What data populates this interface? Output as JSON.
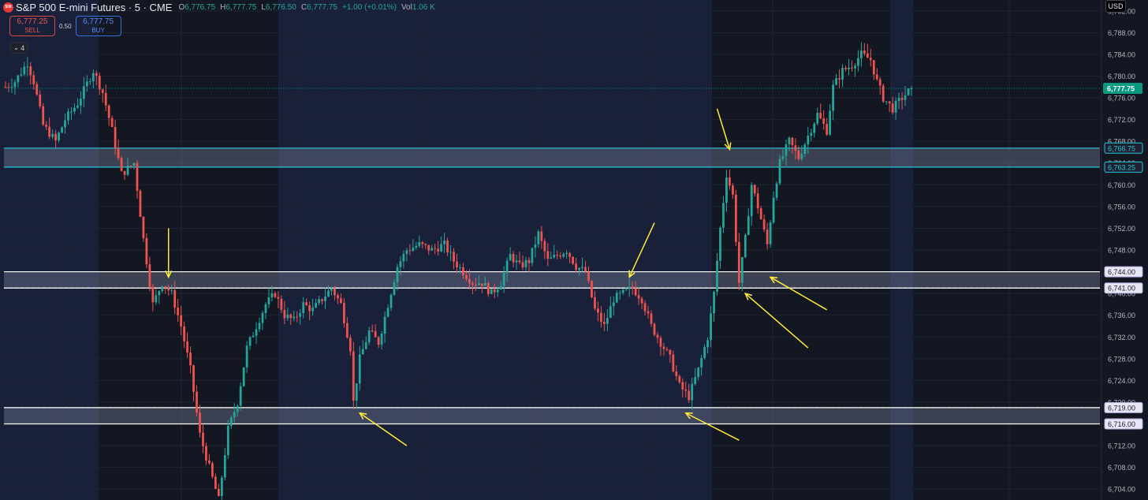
{
  "header": {
    "symbol_badge": "500",
    "symbol": "S&P 500 E-mini Futures · 5 · CME",
    "open_label": "O",
    "open": "6,776.75",
    "high_label": "H",
    "high": "6,777.75",
    "low_label": "L",
    "low": "6,776.50",
    "close_label": "C",
    "close": "6,777.75",
    "change": "+1.00 (+0.01%)",
    "vol_label": "Vol",
    "vol": "1.06 K"
  },
  "trade": {
    "sell_price": "6,777.25",
    "sell_label": "SELL",
    "spread": "0.50",
    "buy_price": "6,777.75",
    "buy_label": "BUY"
  },
  "indicator_toggle": {
    "icon": "chevron-down-icon",
    "count": "4"
  },
  "currency": "USD",
  "colors": {
    "background": "#131722",
    "session_shade": "#18203a",
    "up_candle": "#26a69a",
    "down_candle": "#ef5350",
    "zone_cyan": "#26c6da",
    "zone_white": "#ffffff",
    "arrow": "#ffeb3b",
    "last_price_badge": "#089981"
  },
  "chart_data": {
    "type": "candlestick",
    "title": "S&P 500 E-mini Futures",
    "interval": "5",
    "exchange": "CME",
    "ylim": [
      6702,
      6794
    ],
    "y_ticks": [
      6792,
      6788,
      6784,
      6780,
      6776,
      6772,
      6768,
      6764,
      6760,
      6756,
      6752,
      6748,
      6744,
      6740,
      6736,
      6732,
      6728,
      6724,
      6720,
      6716,
      6712,
      6708,
      6704
    ],
    "y_tick_format": "thousands-comma-2dp",
    "last_price": {
      "value": 6777.75,
      "label": "6,777.75"
    },
    "zones": [
      {
        "top": 6766.75,
        "bottom": 6763.25,
        "top_label": "6,766.75",
        "bottom_label": "6,763.25",
        "color": "cyan"
      },
      {
        "top": 6744.0,
        "bottom": 6741.0,
        "top_label": "6,744.00",
        "bottom_label": "6,741.00",
        "color": "white",
        "dashed_line_at": 6741.0
      },
      {
        "top": 6719.0,
        "bottom": 6716.0,
        "top_label": "6,719.00",
        "bottom_label": "6,716.00",
        "color": "white",
        "dashed_line_at": 6719.0
      }
    ],
    "price_path_keypoints": [
      [
        0,
        6778
      ],
      [
        3,
        6779
      ],
      [
        7,
        6782.5
      ],
      [
        9,
        6779
      ],
      [
        12,
        6771
      ],
      [
        16,
        6768
      ],
      [
        19,
        6772
      ],
      [
        23,
        6775
      ],
      [
        28,
        6781
      ],
      [
        31,
        6777
      ],
      [
        34,
        6770
      ],
      [
        37,
        6762
      ],
      [
        41,
        6764
      ],
      [
        44,
        6750
      ],
      [
        47,
        6738
      ],
      [
        50,
        6742
      ],
      [
        53,
        6740
      ],
      [
        56,
        6734
      ],
      [
        59,
        6726
      ],
      [
        62,
        6714
      ],
      [
        65,
        6708
      ],
      [
        68,
        6702
      ],
      [
        71,
        6715
      ],
      [
        74,
        6720
      ],
      [
        77,
        6730
      ],
      [
        80,
        6734
      ],
      [
        83,
        6738
      ],
      [
        86,
        6740
      ],
      [
        89,
        6736
      ],
      [
        92,
        6735
      ],
      [
        95,
        6738
      ],
      [
        98,
        6737
      ],
      [
        101,
        6739
      ],
      [
        104,
        6741
      ],
      [
        107,
        6738
      ],
      [
        110,
        6730
      ],
      [
        111,
        6720
      ],
      [
        113,
        6728
      ],
      [
        116,
        6733
      ],
      [
        119,
        6731
      ],
      [
        122,
        6738
      ],
      [
        125,
        6745
      ],
      [
        128,
        6748
      ],
      [
        132,
        6749
      ],
      [
        136,
        6748
      ],
      [
        140,
        6749
      ],
      [
        143,
        6746
      ],
      [
        146,
        6744
      ],
      [
        149,
        6742
      ],
      [
        152,
        6742
      ],
      [
        155,
        6740
      ],
      [
        158,
        6742
      ],
      [
        161,
        6747
      ],
      [
        164,
        6745
      ],
      [
        167,
        6746
      ],
      [
        170,
        6751
      ],
      [
        173,
        6746
      ],
      [
        176,
        6747
      ],
      [
        179,
        6748
      ],
      [
        182,
        6745
      ],
      [
        185,
        6744
      ],
      [
        188,
        6737
      ],
      [
        191,
        6734
      ],
      [
        194,
        6739
      ],
      [
        197,
        6740
      ],
      [
        200,
        6741
      ],
      [
        203,
        6739
      ],
      [
        206,
        6734
      ],
      [
        209,
        6731
      ],
      [
        212,
        6728
      ],
      [
        215,
        6723
      ],
      [
        218,
        6721
      ],
      [
        221,
        6726
      ],
      [
        224,
        6732
      ],
      [
        226,
        6740
      ],
      [
        228,
        6752
      ],
      [
        230,
        6762
      ],
      [
        232,
        6758
      ],
      [
        234,
        6742
      ],
      [
        236,
        6750
      ],
      [
        238,
        6760
      ],
      [
        240,
        6756
      ],
      [
        243,
        6749
      ],
      [
        245,
        6758
      ],
      [
        247,
        6764
      ],
      [
        250,
        6768
      ],
      [
        253,
        6765
      ],
      [
        256,
        6769
      ],
      [
        259,
        6773
      ],
      [
        262,
        6770
      ],
      [
        264,
        6778
      ],
      [
        267,
        6781
      ],
      [
        270,
        6782
      ],
      [
        273,
        6784
      ],
      [
        276,
        6783
      ],
      [
        278,
        6779
      ],
      [
        280,
        6776
      ],
      [
        283,
        6774
      ],
      [
        286,
        6776
      ],
      [
        289,
        6777.75
      ]
    ],
    "annotations": [
      {
        "type": "arrow",
        "from": [
          52,
          6752
        ],
        "to": [
          52,
          6743
        ],
        "note": ""
      },
      {
        "type": "arrow",
        "from": [
          128,
          6712
        ],
        "to": [
          113,
          6718
        ],
        "note": ""
      },
      {
        "type": "arrow",
        "from": [
          207,
          6753
        ],
        "to": [
          199,
          6743
        ],
        "note": ""
      },
      {
        "type": "arrow",
        "from": [
          234,
          6713
        ],
        "to": [
          217,
          6718
        ],
        "note": ""
      },
      {
        "type": "arrow",
        "from": [
          227,
          6774
        ],
        "to": [
          231,
          6766.5
        ],
        "note": ""
      },
      {
        "type": "arrow",
        "from": [
          256,
          6730
        ],
        "to": [
          236,
          6740
        ],
        "note": ""
      },
      {
        "type": "arrow",
        "from": [
          262,
          6737
        ],
        "to": [
          244,
          6743
        ],
        "note": ""
      }
    ],
    "bars_total": 290,
    "session_shading": "alternating dark / navy by trading session",
    "grid": true
  }
}
